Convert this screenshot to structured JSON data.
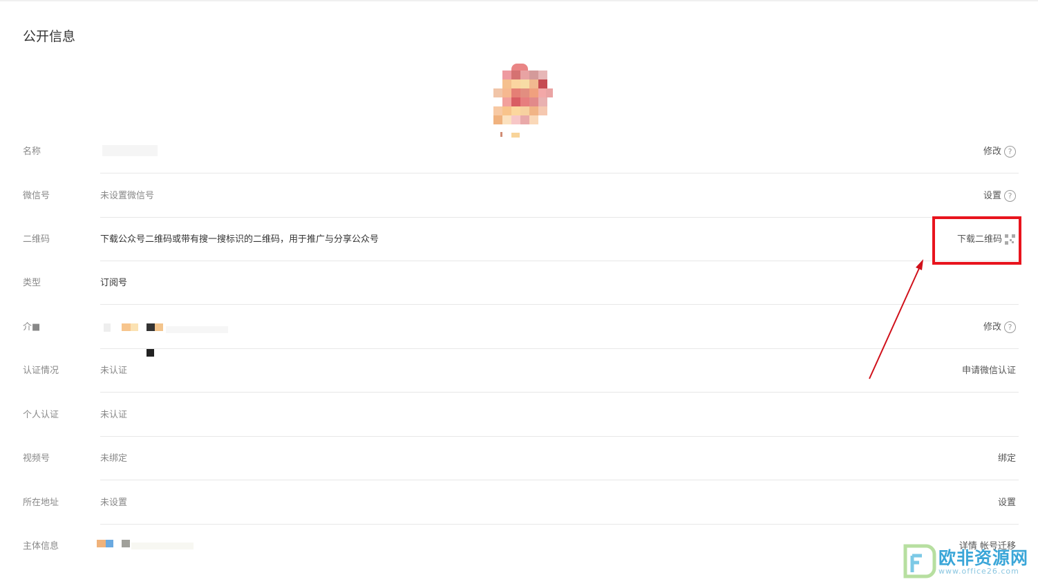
{
  "section": {
    "title": "公开信息"
  },
  "rows": [
    {
      "label": "名称",
      "value": "",
      "action": "修改"
    },
    {
      "label": "微信号",
      "value": "未设置微信号",
      "action": "设置"
    },
    {
      "label": "二维码",
      "value": "下载公众号二维码或带有搜一搜标识的二维码，用于推广与分享公众号",
      "action": "下载二维码"
    },
    {
      "label": "类型",
      "value": "订阅号",
      "action": ""
    },
    {
      "label": "介■",
      "value": "",
      "action": "修改"
    },
    {
      "label": "认证情况",
      "value": "未认证",
      "action": "申请微信认证"
    },
    {
      "label": "个人认证",
      "value": "未认证",
      "action": ""
    },
    {
      "label": "视频号",
      "value": "未绑定",
      "action": "绑定"
    },
    {
      "label": "所在地址",
      "value": "未设置",
      "action": "设置"
    },
    {
      "label": "主体信息",
      "value": "",
      "action": "详情 帐号迁移"
    }
  ],
  "icons": {
    "help": "?",
    "qr": "qr-code-icon"
  },
  "colors": {
    "highlight": "#e8141d",
    "arrow": "#d0101a",
    "watermark": "#3aa6d8"
  },
  "watermark": {
    "text": "欧非资源网",
    "sub": "www.office26.com"
  }
}
